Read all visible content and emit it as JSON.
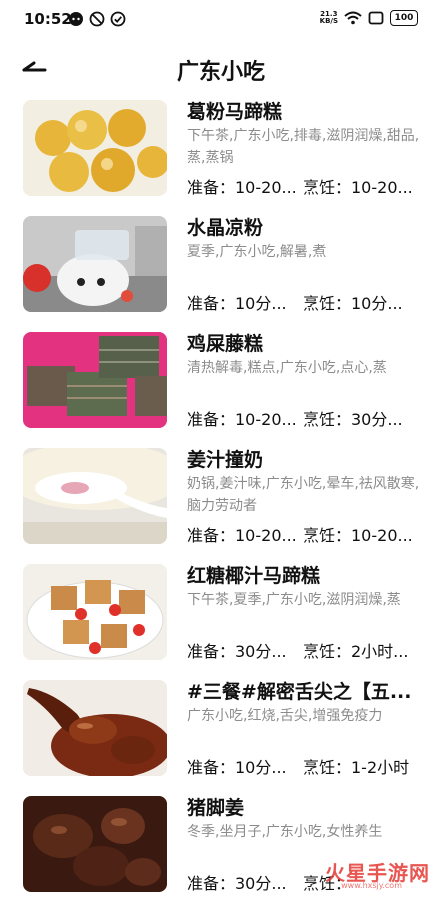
{
  "status_bar": {
    "time": "10:52",
    "net_speed_value": "21.3",
    "net_speed_unit": "KB/S",
    "battery": "100"
  },
  "header": {
    "title": "广东小吃"
  },
  "recipes": [
    {
      "title": "葛粉马蹄糕",
      "tags": "下午茶,广东小吃,排毒,滋阴润燥,甜品,蒸,蒸锅",
      "prep": "准备：10-20...",
      "cook": "烹饪：10-20..."
    },
    {
      "title": "水晶凉粉",
      "tags": "夏季,广东小吃,解暑,煮",
      "prep": "准备：10分...",
      "cook": "烹饪：10分..."
    },
    {
      "title": "鸡屎藤糕",
      "tags": "清热解毒,糕点,广东小吃,点心,蒸",
      "prep": "准备：10-20...",
      "cook": "烹饪：30分..."
    },
    {
      "title": "姜汁撞奶",
      "tags": "奶锅,姜汁味,广东小吃,晕车,祛风散寒,脑力劳动者",
      "prep": "准备：10-20...",
      "cook": "烹饪：10-20..."
    },
    {
      "title": "红糖椰汁马蹄糕",
      "tags": "下午茶,夏季,广东小吃,滋阴润燥,蒸",
      "prep": "准备：30分...",
      "cook": "烹饪：2小时..."
    },
    {
      "title": "#三餐#解密舌尖之【五...",
      "tags": "广东小吃,红烧,舌尖,增强免疫力",
      "prep": "准备：10分...",
      "cook": "烹饪：1-2小时"
    },
    {
      "title": "猪脚姜",
      "tags": "冬季,坐月子,广东小吃,女性养生",
      "prep": "准备：30分...",
      "cook": "烹饪："
    }
  ],
  "watermark": {
    "text": "火星手游网",
    "sub": "www.hxsjy.com"
  }
}
